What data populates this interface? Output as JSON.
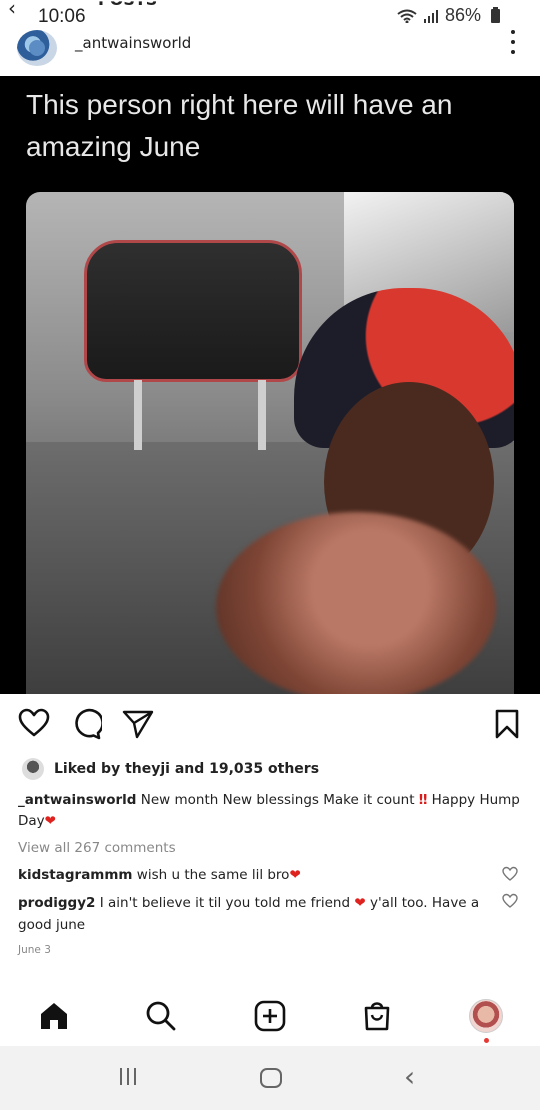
{
  "status_bar": {
    "time": "10:06",
    "battery": "86%",
    "cut_text": "POSTS"
  },
  "post": {
    "username": "_antwainsworld",
    "overlay_text": "This person right here will have an amazing June",
    "likes_text": "Liked by theyji and 19,035 others",
    "caption": {
      "user": "_antwainsworld",
      "text_a": "New month New blessings Make it count",
      "bang": "‼",
      "text_b": "Happy Hump Day",
      "heart": "❤"
    },
    "view_all": "View all 267 comments",
    "comments": [
      {
        "user": "kidstagrammm",
        "text": "wish u the same lil bro",
        "heart": "❤"
      },
      {
        "user": "prodiggy2",
        "text_a": "I ain't believe it til you told me friend",
        "heart": "❤",
        "text_b": "y'all too. Have a good june"
      }
    ],
    "date": "June 3"
  },
  "icons": {
    "like": "heart-icon",
    "comment": "comment-icon",
    "share": "send-icon",
    "save": "bookmark-icon",
    "home": "home-icon",
    "search": "search-icon",
    "create": "add-icon",
    "shop": "shop-icon"
  },
  "colors": {
    "accent_red": "#e0221f",
    "muted": "#888888"
  }
}
